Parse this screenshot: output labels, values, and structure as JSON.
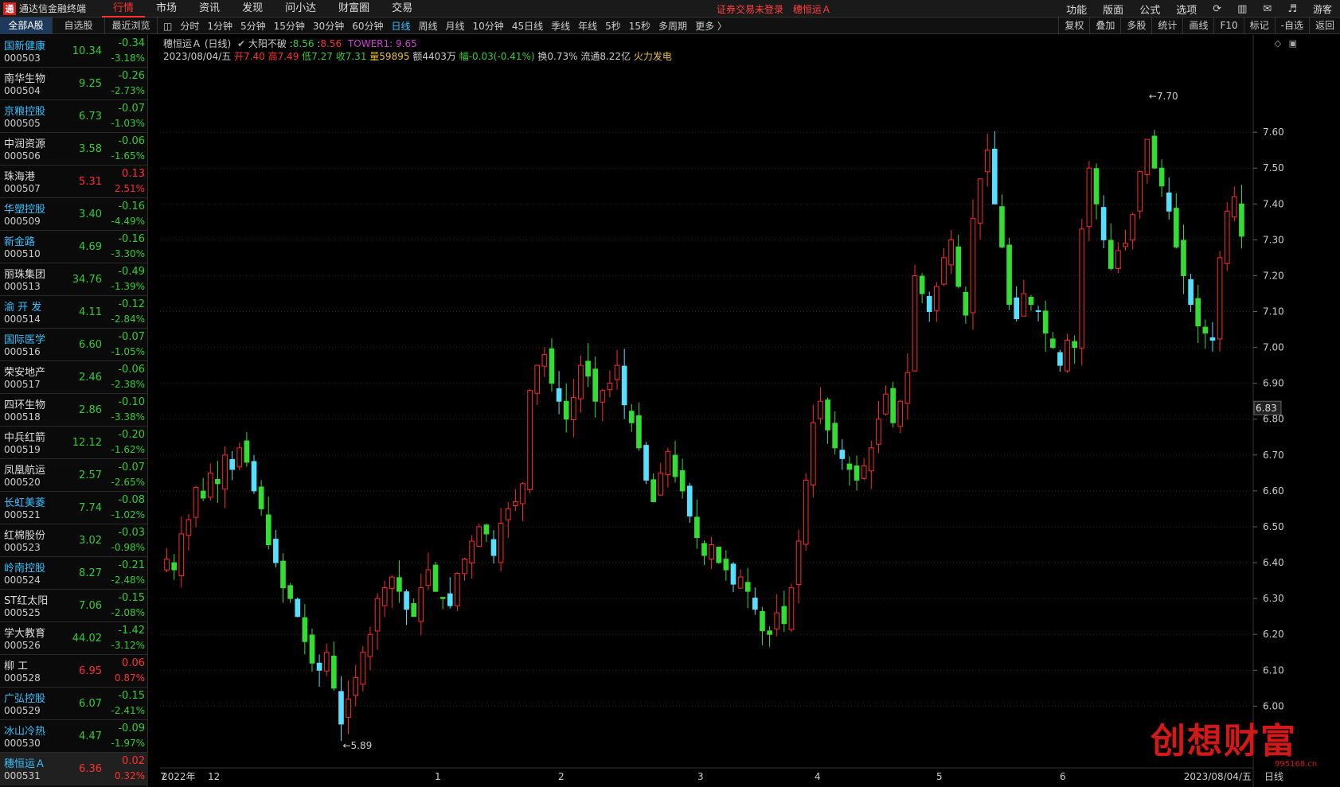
{
  "app": {
    "title": "通达信金融终端",
    "logo_char": "通"
  },
  "top_menu": [
    "行情",
    "市场",
    "资讯",
    "发现",
    "问小达",
    "财富圈",
    "交易"
  ],
  "login_status": "证券交易未登录",
  "login_stock": "穗恒运Ａ",
  "top_right": [
    "功能",
    "版面",
    "公式",
    "选项"
  ],
  "guest": "游客",
  "left_tabs": [
    "全部A股",
    "自选股",
    "最近浏览"
  ],
  "periods": [
    "分时",
    "1分钟",
    "5分钟",
    "15分钟",
    "30分钟",
    "60分钟",
    "日线",
    "周线",
    "月线",
    "10分钟",
    "45日线",
    "季线",
    "年线",
    "5秒",
    "15秒",
    "多周期",
    "更多 〉"
  ],
  "chart_tools": [
    "复权",
    "叠加",
    "多股",
    "统计",
    "画线",
    "F10",
    "标记",
    "-自选",
    "返回"
  ],
  "stocks": [
    {
      "name": "国新健康",
      "code": "000503",
      "price": "10.34",
      "chg": "-0.34",
      "pct": "-3.18%",
      "dir": "down",
      "cyan": true
    },
    {
      "name": "南华生物",
      "code": "000504",
      "price": "9.25",
      "chg": "-0.26",
      "pct": "-2.73%",
      "dir": "down",
      "cyan": false
    },
    {
      "name": "京粮控股",
      "code": "000505",
      "price": "6.73",
      "chg": "-0.07",
      "pct": "-1.03%",
      "dir": "down",
      "cyan": true
    },
    {
      "name": "中润资源",
      "code": "000506",
      "price": "3.58",
      "chg": "-0.06",
      "pct": "-1.65%",
      "dir": "down",
      "cyan": false
    },
    {
      "name": "珠海港",
      "code": "000507",
      "price": "5.31",
      "chg": "0.13",
      "pct": "2.51%",
      "dir": "up",
      "cyan": false
    },
    {
      "name": "华塑控股",
      "code": "000509",
      "price": "3.40",
      "chg": "-0.16",
      "pct": "-4.49%",
      "dir": "down",
      "cyan": true
    },
    {
      "name": "新金路",
      "code": "000510",
      "price": "4.69",
      "chg": "-0.16",
      "pct": "-3.30%",
      "dir": "down",
      "cyan": true
    },
    {
      "name": "丽珠集团",
      "code": "000513",
      "price": "34.76",
      "chg": "-0.49",
      "pct": "-1.39%",
      "dir": "down",
      "cyan": false
    },
    {
      "name": "渝 开 发",
      "code": "000514",
      "price": "4.11",
      "chg": "-0.12",
      "pct": "-2.84%",
      "dir": "down",
      "cyan": true
    },
    {
      "name": "国际医学",
      "code": "000516",
      "price": "6.60",
      "chg": "-0.07",
      "pct": "-1.05%",
      "dir": "down",
      "cyan": true
    },
    {
      "name": "荣安地产",
      "code": "000517",
      "price": "2.46",
      "chg": "-0.06",
      "pct": "-2.38%",
      "dir": "down",
      "cyan": false
    },
    {
      "name": "四环生物",
      "code": "000518",
      "price": "2.86",
      "chg": "-0.10",
      "pct": "-3.38%",
      "dir": "down",
      "cyan": false
    },
    {
      "name": "中兵红箭",
      "code": "000519",
      "price": "12.12",
      "chg": "-0.20",
      "pct": "-1.62%",
      "dir": "down",
      "cyan": false
    },
    {
      "name": "凤凰航运",
      "code": "000520",
      "price": "2.57",
      "chg": "-0.07",
      "pct": "-2.65%",
      "dir": "down",
      "cyan": false
    },
    {
      "name": "长虹美菱",
      "code": "000521",
      "price": "7.74",
      "chg": "-0.08",
      "pct": "-1.02%",
      "dir": "down",
      "cyan": true
    },
    {
      "name": "红棉股份",
      "code": "000523",
      "price": "3.02",
      "chg": "-0.03",
      "pct": "-0.98%",
      "dir": "down",
      "cyan": false
    },
    {
      "name": "岭南控股",
      "code": "000524",
      "price": "8.27",
      "chg": "-0.21",
      "pct": "-2.48%",
      "dir": "down",
      "cyan": true
    },
    {
      "name": "ST红太阳",
      "code": "000525",
      "price": "7.06",
      "chg": "-0.15",
      "pct": "-2.08%",
      "dir": "down",
      "cyan": false
    },
    {
      "name": "学大教育",
      "code": "000526",
      "price": "44.02",
      "chg": "-1.42",
      "pct": "-3.12%",
      "dir": "down",
      "cyan": false
    },
    {
      "name": "柳 工",
      "code": "000528",
      "price": "6.95",
      "chg": "0.06",
      "pct": "0.87%",
      "dir": "up",
      "cyan": false
    },
    {
      "name": "广弘控股",
      "code": "000529",
      "price": "6.07",
      "chg": "-0.15",
      "pct": "-2.41%",
      "dir": "down",
      "cyan": true
    },
    {
      "name": "冰山冷热",
      "code": "000530",
      "price": "4.47",
      "chg": "-0.09",
      "pct": "-1.97%",
      "dir": "down",
      "cyan": true
    },
    {
      "name": "穗恒运Ａ",
      "code": "000531",
      "price": "6.36",
      "chg": "0.02",
      "pct": "0.32%",
      "dir": "up",
      "cyan": true,
      "selected": true
    }
  ],
  "chart_header": {
    "stock": "穗恒运Ａ (日线)",
    "indicator": "大阳不破",
    "ind_v1": "8.56",
    "ind_v2": "8.56",
    "tower": "TOWER1: 9.65",
    "date": "2023/08/04/五",
    "open": "开7.40",
    "high": "高7.49",
    "low": "低7.27",
    "close": "收7.31",
    "vol": "量59895",
    "amt": "额4403万",
    "range": "幅-0.03(-0.41%)",
    "turnover": "换0.73%",
    "float_cap": "流通8.22亿",
    "concept": "火力发电"
  },
  "chart_data": {
    "type": "candlestick",
    "yticks": [
      "7.60",
      "7.50",
      "7.40",
      "7.30",
      "7.20",
      "7.10",
      "7.00",
      "6.90",
      "6.80",
      "6.70",
      "6.60",
      "6.50",
      "6.40",
      "6.30",
      "6.20",
      "6.10",
      "6.00"
    ],
    "ylim": [
      5.83,
      7.76
    ],
    "last_price_label": "6.83",
    "x_labels": [
      "2022年",
      "12",
      "1",
      "2",
      "3",
      "4",
      "5",
      "6",
      "7"
    ],
    "x_end_label": "2023/08/04/五",
    "x_unit": "日线",
    "max_label": "7.70",
    "min_label": "5.89",
    "colors": {
      "up": "#ff2a2a",
      "down": "#33dd33",
      "down_alt": "#55e0ff",
      "grid": "#2a2a2a"
    },
    "closes": [
      6.41,
      6.38,
      6.48,
      6.52,
      6.61,
      6.58,
      6.65,
      6.62,
      6.7,
      6.66,
      6.72,
      6.68,
      6.6,
      6.55,
      6.45,
      6.4,
      6.33,
      6.3,
      6.25,
      6.18,
      6.12,
      6.1,
      6.15,
      6.05,
      5.95,
      6.02,
      6.08,
      6.15,
      6.2,
      6.3,
      6.33,
      6.36,
      6.32,
      6.27,
      6.25,
      6.33,
      6.38,
      6.32,
      6.3,
      6.28,
      6.37,
      6.41,
      6.46,
      6.5,
      6.48,
      6.42,
      6.51,
      6.55,
      6.57,
      6.62,
      6.88,
      6.95,
      6.98,
      6.9,
      6.85,
      6.8,
      6.86,
      6.95,
      6.92,
      6.85,
      6.88,
      6.9,
      6.95,
      6.84,
      6.79,
      6.72,
      6.63,
      6.57,
      6.65,
      6.71,
      6.64,
      6.6,
      6.53,
      6.47,
      6.42,
      6.45,
      6.4,
      6.38,
      6.34,
      6.36,
      6.32,
      6.27,
      6.21,
      6.2,
      6.26,
      6.23,
      6.33,
      6.46,
      6.63,
      6.79,
      6.85,
      6.77,
      6.72,
      6.69,
      6.66,
      6.63,
      6.67,
      6.72,
      6.8,
      6.87,
      6.79,
      6.85,
      6.93,
      7.2,
      7.15,
      7.1,
      7.17,
      7.25,
      7.3,
      7.17,
      7.09,
      7.36,
      7.47,
      7.55,
      7.4,
      7.28,
      7.12,
      7.08,
      7.15,
      7.12,
      7.1,
      7.04,
      7.0,
      6.95,
      7.02,
      7.0,
      7.33,
      7.5,
      7.4,
      7.3,
      7.22,
      7.27,
      7.29,
      7.37,
      7.49,
      7.58,
      7.5,
      7.45,
      7.38,
      7.28,
      7.2,
      7.12,
      7.06,
      7.04,
      7.02,
      7.25,
      7.38,
      7.42,
      7.31
    ],
    "volatility": 0.055
  },
  "watermark": {
    "text": "创想财富",
    "url": "995168.cn"
  }
}
